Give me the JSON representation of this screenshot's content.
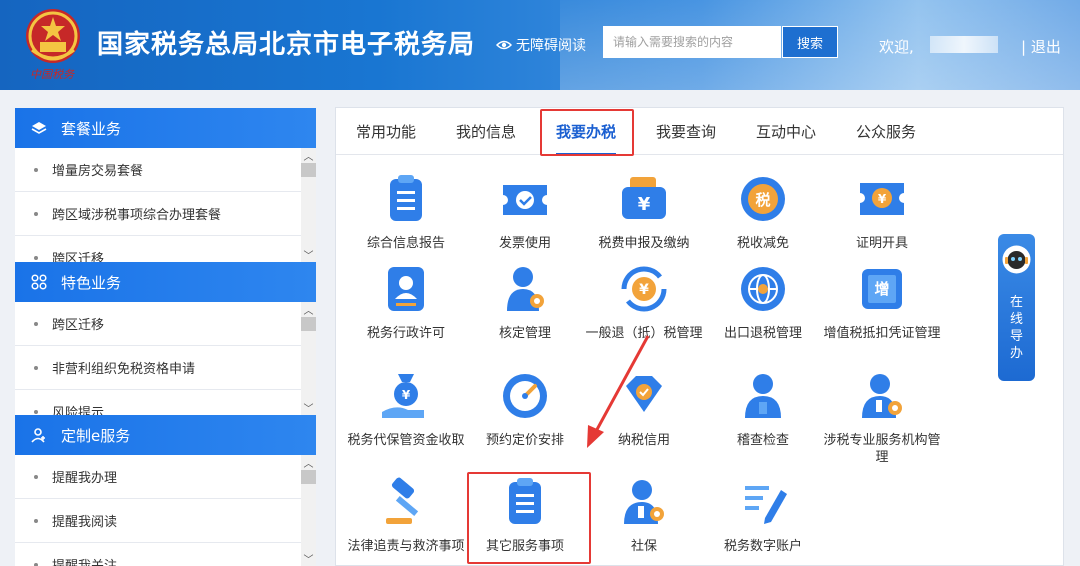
{
  "header": {
    "site_title": "国家税务总局北京市电子税务局",
    "accessibility_label": "无障碍阅读",
    "search_placeholder": "请输入需要搜索的内容",
    "search_button": "搜索",
    "welcome": "欢迎,",
    "logout": "| 退出",
    "brand_color": "#1976d2"
  },
  "sidebar": {
    "sections": [
      {
        "title": "套餐业务",
        "icon": "layers-icon",
        "items": [
          "增量房交易套餐",
          "跨区域涉税事项综合办理套餐",
          "跨区迁移"
        ]
      },
      {
        "title": "特色业务",
        "icon": "grid-icon",
        "items": [
          "跨区迁移",
          "非营利组织免税资格申请",
          "风险提示"
        ]
      },
      {
        "title": "定制e服务",
        "icon": "user-plus-icon",
        "items": [
          "提醒我办理",
          "提醒我阅读",
          "提醒我关注"
        ]
      }
    ]
  },
  "tabs": [
    {
      "label": "常用功能"
    },
    {
      "label": "我的信息"
    },
    {
      "label": "我要办税",
      "active": true
    },
    {
      "label": "我要查询"
    },
    {
      "label": "互动中心"
    },
    {
      "label": "公众服务"
    }
  ],
  "functions": [
    {
      "label": "综合信息报告",
      "icon": "report-doc-icon"
    },
    {
      "label": "发票使用",
      "icon": "invoice-ticket-icon"
    },
    {
      "label": "税费申报及缴纳",
      "icon": "wallet-yuan-icon"
    },
    {
      "label": "税收减免",
      "icon": "tax-reduction-coin-icon"
    },
    {
      "label": "证明开具",
      "icon": "certificate-coin-icon"
    },
    {
      "label": "税务行政许可",
      "icon": "id-card-icon"
    },
    {
      "label": "核定管理",
      "icon": "user-gear-icon"
    },
    {
      "label": "一般退（抵）税管理",
      "icon": "refund-cycle-yuan-icon"
    },
    {
      "label": "出口退税管理",
      "icon": "globe-export-icon"
    },
    {
      "label": "增值税抵扣凭证管理",
      "icon": "vat-ticket-icon"
    },
    {
      "label": "税务代保管资金收取",
      "icon": "hand-money-bag-icon"
    },
    {
      "label": "预约定价安排",
      "icon": "gauge-compass-icon"
    },
    {
      "label": "纳税信用",
      "icon": "credit-diamond-icon"
    },
    {
      "label": "稽查检查",
      "icon": "inspector-user-icon"
    },
    {
      "label": "涉税专业服务机构管理",
      "icon": "agent-user-gear-icon"
    },
    {
      "label": "法律追责与救济事项",
      "icon": "gavel-icon"
    },
    {
      "label": "其它服务事项",
      "icon": "clipboard-list-icon",
      "highlighted": true
    },
    {
      "label": "社保",
      "icon": "social-security-user-icon"
    },
    {
      "label": "税务数字账户",
      "icon": "pen-list-icon"
    }
  ],
  "online_guide": {
    "label": "在线导办",
    "icon": "robot-assistant-icon"
  },
  "colors": {
    "highlight": "#e53935",
    "active_tab": "#1a5fd1",
    "sidebar_head": "#1a73e8"
  }
}
